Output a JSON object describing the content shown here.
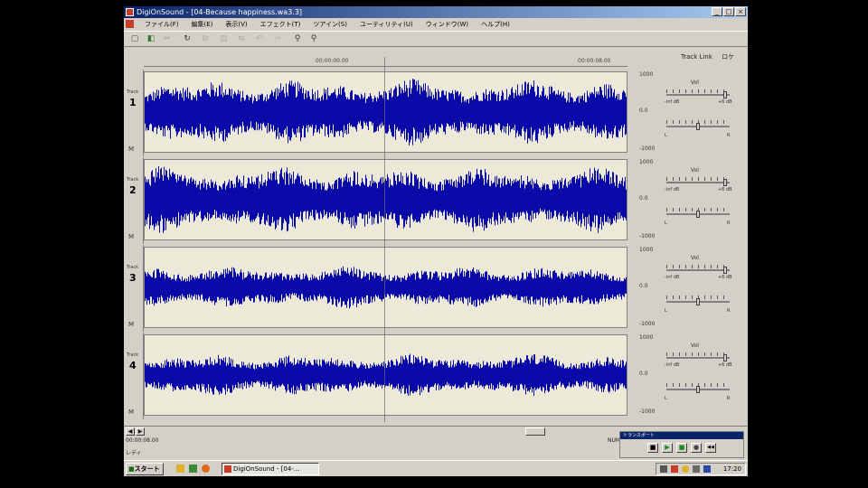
{
  "window": {
    "title": "DigiOnSound - [04-Because happiness.wa3.3]",
    "buttons": [
      "_",
      "□",
      "×"
    ]
  },
  "menu": [
    "ファイル(F)",
    "編集(E)",
    "表示(V)",
    "エフェクト(T)",
    "ツアイン(S)",
    "ユーティリティ(U)",
    "ウィンドウ(W)",
    "ヘルプ(H)"
  ],
  "toolbar": {
    "icons": [
      "new-icon",
      "open-icon",
      "cut-icon",
      "redo-icon",
      "copy-icon",
      "paste-icon",
      "mix-icon",
      "undo-icon",
      "arrow-icon",
      "zoom-in-icon",
      "zoom-out-icon"
    ]
  },
  "header": {
    "track_label": "Track Link",
    "mode": "ロケ"
  },
  "ruler": {
    "labels": [
      "00:00:00.00",
      "00:00:08.00"
    ]
  },
  "tracks": [
    {
      "name": "Track",
      "number": "1",
      "mute": "M",
      "scale": [
        "1000",
        "0.0",
        "-1000"
      ],
      "vol_label": "Vol",
      "range_left": "-inf dB",
      "range_right": "+6 dB",
      "pan_left": "L",
      "pan_right": "R",
      "vol_level": 0.95,
      "pan_level": 0.5,
      "amplitude": 0.85
    },
    {
      "name": "Track",
      "number": "2",
      "mute": "M",
      "scale": [
        "1000",
        "0.0",
        "-1000"
      ],
      "vol_label": "Vol",
      "range_left": "-inf dB",
      "range_right": "+6 dB",
      "pan_left": "L",
      "pan_right": "R",
      "vol_level": 0.95,
      "pan_level": 0.5,
      "amplitude": 0.85
    },
    {
      "name": "Track",
      "number": "3",
      "mute": "M",
      "scale": [
        "1000",
        "0.0",
        "-1000"
      ],
      "vol_label": "Vol",
      "range_left": "-inf dB",
      "range_right": "+6 dB",
      "pan_left": "L",
      "pan_right": "R",
      "vol_level": 0.95,
      "pan_level": 0.5,
      "amplitude": 0.55
    },
    {
      "name": "Track",
      "number": "4",
      "mute": "M",
      "scale": [
        "1000",
        "0.0",
        "-1000"
      ],
      "vol_label": "Vol",
      "range_left": "-inf dB",
      "range_right": "+6 dB",
      "pan_left": "L",
      "pan_right": "R",
      "vol_level": 0.95,
      "pan_level": 0.5,
      "amplitude": 0.55
    }
  ],
  "scroll": {
    "left": "◀",
    "right": "▶"
  },
  "status": {
    "position": "00:00:08.00",
    "ready": "レディ",
    "num": "NUM"
  },
  "transport": {
    "title": "トランスポート",
    "buttons": [
      "■",
      "▶",
      "■",
      "●",
      "◀◀"
    ],
    "icons": [
      "stop-icon",
      "play-icon",
      "pause-icon",
      "record-icon",
      "rewind-icon"
    ]
  },
  "taskbar": {
    "start": "スタート",
    "task": "DigiOnSound - [04-...",
    "clock": "17:20"
  },
  "colors": {
    "waveform": "#0a0aa8",
    "title_gradient_start": "#0a246a",
    "title_gradient_end": "#a6caf0",
    "window_bg": "#d4d0c8"
  }
}
